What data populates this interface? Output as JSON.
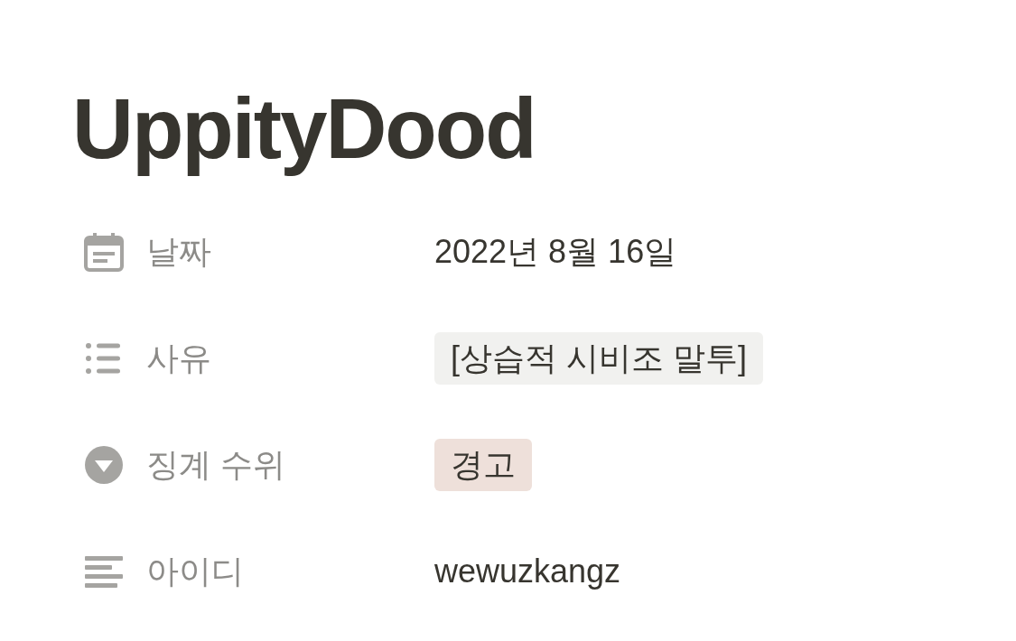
{
  "title": "UppityDood",
  "properties": [
    {
      "kind": "date",
      "label": "날짜",
      "value": "2022년 8월 16일"
    },
    {
      "kind": "multi_select",
      "label": "사유",
      "tags": [
        {
          "text": "[상습적 시비조 말투]",
          "color": "#f1f1ef"
        }
      ]
    },
    {
      "kind": "select",
      "label": "징계 수위",
      "tags": [
        {
          "text": "경고",
          "color": "#eee0da"
        }
      ]
    },
    {
      "kind": "text",
      "label": "아이디",
      "value": "wewuzkangz"
    }
  ]
}
